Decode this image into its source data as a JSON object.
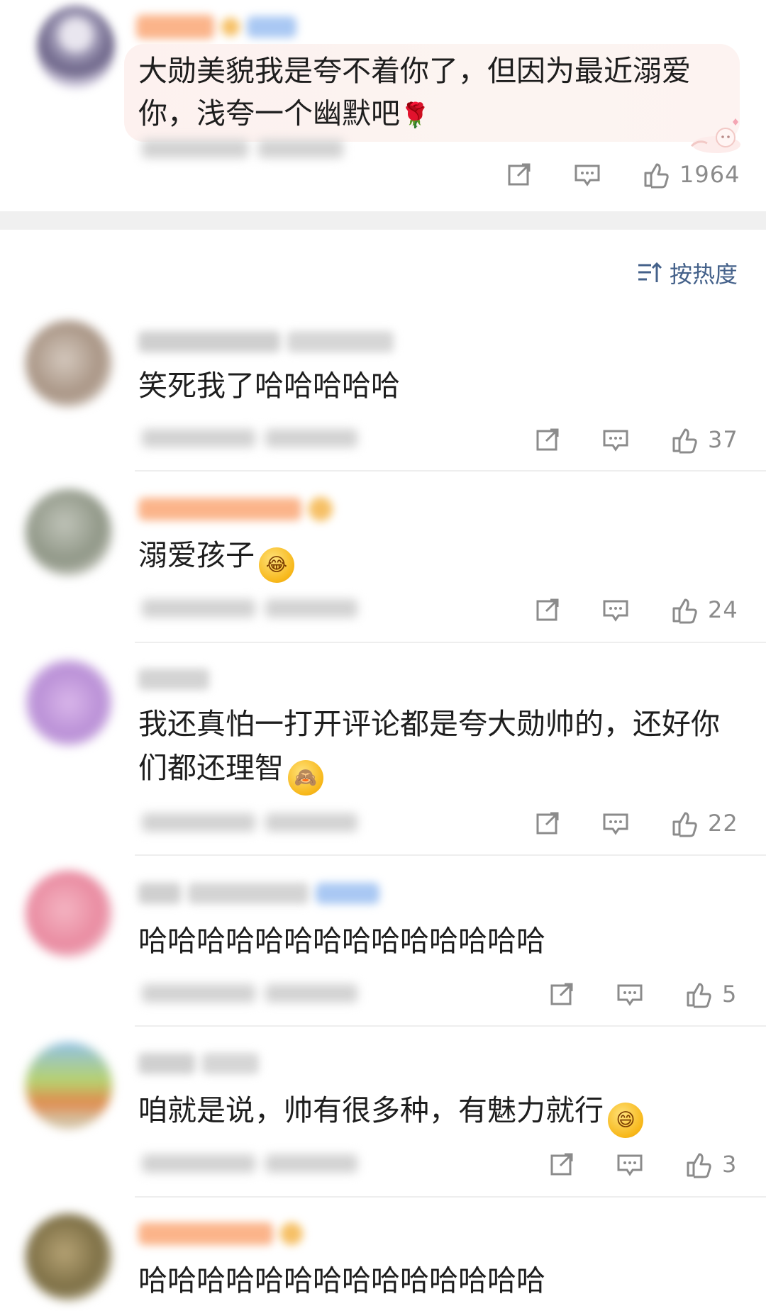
{
  "top_comment": {
    "text": "大勋美貌我是夸不着你了，但因为最近溺爱你，浅夸一个幽默吧",
    "emoji": "rose-emoji",
    "likes": "1964"
  },
  "sort": {
    "label": "按热度",
    "icon": "sort-icon"
  },
  "comments": [
    {
      "text": "笑死我了哈哈哈哈哈",
      "likes": "37",
      "emoji": ""
    },
    {
      "text": "溺爱孩子",
      "likes": "24",
      "emoji": "laughing-tears-emoji"
    },
    {
      "text": "我还真怕一打开评论都是夸大勋帅的，还好你们都还理智",
      "likes": "22",
      "emoji": "cover-face-emoji"
    },
    {
      "text": "哈哈哈哈哈哈哈哈哈哈哈哈哈哈",
      "likes": "5",
      "emoji": ""
    },
    {
      "text": "咱就是说，帅有很多种，有魅力就行",
      "likes": "3",
      "emoji": "grinning-emoji"
    },
    {
      "text": "哈哈哈哈哈哈哈哈哈哈哈哈哈哈",
      "likes": "",
      "emoji": ""
    }
  ],
  "icons": {
    "share": "share-icon",
    "reply": "comment-icon",
    "like": "thumbs-up-icon"
  },
  "colors": {
    "accent": "#44618a",
    "meta_gray": "#8b8b8b",
    "bubble": "#fdf1ef",
    "divider": "#f0f0f0"
  }
}
